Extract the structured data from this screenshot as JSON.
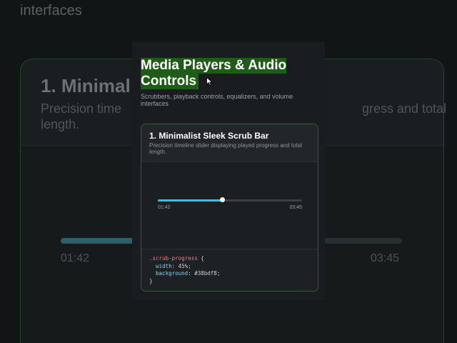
{
  "background": {
    "ghost_text": "interfaces",
    "card_title": "1. Minimal",
    "desc_left": "Precision time",
    "desc_left_2": "length.",
    "desc_right": "gress and total",
    "time_current": "01:42",
    "time_total": "03:45"
  },
  "page": {
    "title": "Media Players & Audio Controls",
    "subtitle": "Scrubbers, playback controls, equalizers, and volume interfaces"
  },
  "card": {
    "title": "1. Minimalist Sleek Scrub Bar",
    "description": "Precision timeline slider displaying played progress and total length."
  },
  "player": {
    "progress_percent": 45,
    "current_time": "01:42",
    "total_time": "03:45",
    "accent_color": "#38bdf8"
  },
  "code": {
    "selector": ".scrub-progress",
    "open": " {",
    "line1_prop": "  width",
    "line1_val": ": 45%;",
    "line2_prop": "  background",
    "line2_val": ": #38bdf8;",
    "close": "}"
  }
}
